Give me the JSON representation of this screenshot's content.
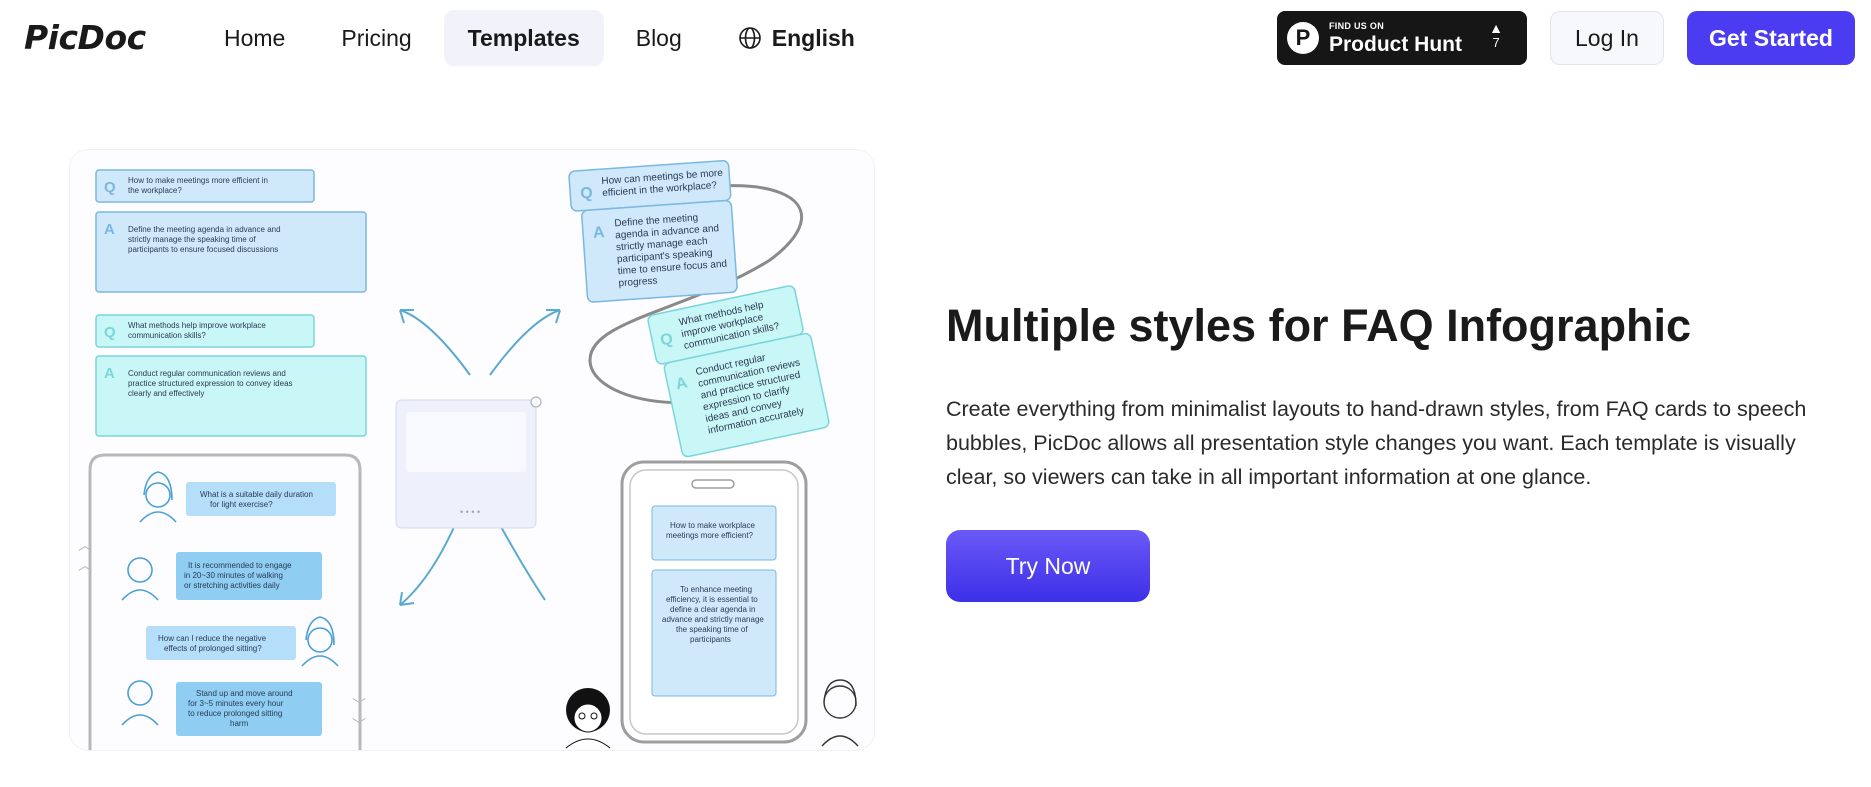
{
  "header": {
    "logo_text": "PicDoc",
    "nav": [
      {
        "label": "Home"
      },
      {
        "label": "Pricing"
      },
      {
        "label": "Templates",
        "active": true
      },
      {
        "label": "Blog"
      },
      {
        "label": "English",
        "icon": "globe-icon"
      }
    ],
    "product_hunt": {
      "small_label": "FIND US ON",
      "big_label": "Product Hunt",
      "votes": "7",
      "icon": "product-hunt-icon"
    },
    "login_label": "Log In",
    "get_started_label": "Get Started"
  },
  "illustration": {
    "cards": {
      "q1": [
        "How to make meetings more efficient in",
        "the workplace?"
      ],
      "a1": [
        "Define the meeting agenda in advance and",
        "strictly manage the speaking time of",
        "participants to ensure focused discussions"
      ],
      "q2": [
        "What methods help improve workplace",
        "communication skills?"
      ],
      "a2": [
        "Conduct regular communication reviews and",
        "practice structured expression to convey ideas",
        "clearly and effectively"
      ]
    },
    "tilted": {
      "q1": [
        "How can meetings be more",
        "efficient in the workplace?"
      ],
      "a1": [
        "Define the meeting",
        "agenda in advance and",
        "strictly manage each",
        "participant's speaking",
        "time to ensure focus and",
        "progress"
      ],
      "q2": [
        "What methods help",
        "improve workplace",
        "communication skills?"
      ],
      "a2": [
        "Conduct regular",
        "communication reviews",
        "and practice structured",
        "expression to clarify",
        "ideas and convey",
        "information accurately"
      ]
    },
    "chat": {
      "b1": [
        "What is a suitable daily duration",
        "for light exercise?"
      ],
      "b2": [
        "It is recommended to engage",
        "in 20~30 minutes of walking",
        "or stretching activities daily"
      ],
      "b3": [
        "How can I reduce the negative",
        "effects of prolonged sitting?"
      ],
      "b4": [
        "Stand up and move around",
        "for 3~5 minutes every hour",
        "to reduce prolonged sitting",
        "harm"
      ]
    },
    "phone": {
      "q": [
        "How to make workplace",
        "meetings more efficient?"
      ],
      "a": [
        "To enhance meeting",
        "efficiency, it is essential to",
        "define a clear agenda in",
        "advance and strictly manage",
        "the speaking time of",
        "participants"
      ]
    },
    "badge_q": "Q",
    "badge_a": "A",
    "accent_blue": "#cfe9fb",
    "accent_cyan": "#c9f6f6",
    "stroke_blue": "#7ab8e0"
  },
  "main": {
    "headline": "Multiple styles for FAQ Infographic",
    "description": "Create everything from minimalist layouts to hand-drawn styles, from FAQ cards to speech bubbles, PicDoc allows all presentation style changes you want. Each template is visually clear, so viewers can take in all important information at one glance.",
    "cta_label": "Try Now",
    "brand_color": "#4b3cf2"
  }
}
